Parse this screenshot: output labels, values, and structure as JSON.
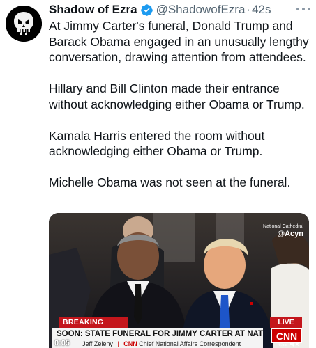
{
  "tweet": {
    "display_name": "Shadow of Ezra",
    "handle": "@ShadowofEzra",
    "separator": "·",
    "time": "42s",
    "icons": {
      "avatar": "punisher-skull-avatar",
      "verified": "verified-badge-icon",
      "more": "more-options-icon"
    },
    "colors": {
      "verified": "#1d9bf0",
      "secondary_text": "#536471",
      "text": "#0f1419"
    },
    "paragraphs": [
      "At Jimmy Carter's funeral, Donald Trump and Barack Obama engaged in an unusually lengthy conversation, drawing attention from attendees.",
      "Hillary and Bill Clinton made their entrance without acknowledging either Obama or Trump.",
      "Kamala Harris entered the room without acknowledging either Obama or Trump.",
      "Michelle Obama was not seen at the funeral."
    ]
  },
  "video": {
    "watermark_top": "National Cathedral",
    "watermark_bottom": "@Acyn",
    "breaking_label": "BREAKING NEWS",
    "live_label": "LIVE",
    "headline": "SOON: STATE FUNERAL FOR JIMMY CARTER AT NATIONAL CATHEDRAL",
    "network_logo": "CNN",
    "reporter": "Jeff Zeleny",
    "network_mini": "CNN",
    "reporter_title": "Chief National Affairs Correspondent",
    "timestamp": "0:05",
    "clock": "6:55",
    "icons": {
      "mute": "speaker-mute-icon"
    },
    "colors": {
      "breaking": "#c4161c",
      "cnn_red": "#cc0000"
    }
  }
}
